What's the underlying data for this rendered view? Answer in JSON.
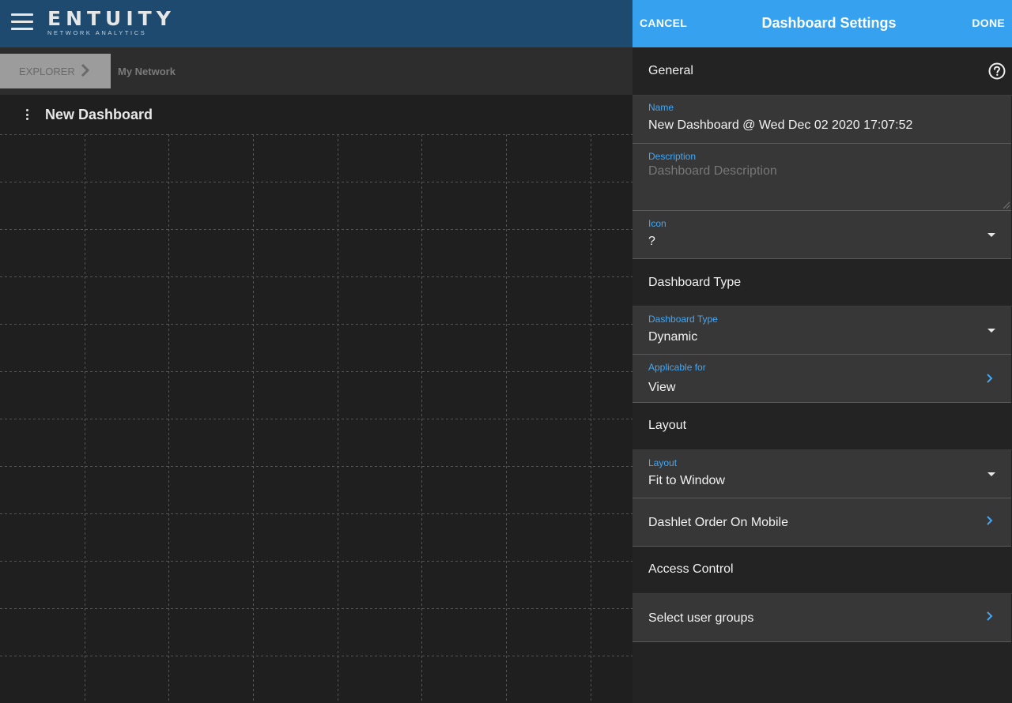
{
  "app": {
    "logo_main": "ENTUITY",
    "logo_sub": "NETWORK ANALYTICS"
  },
  "breadcrumb": {
    "explorer": "EXPLORER",
    "current": "My Network"
  },
  "dashboard": {
    "title": "New Dashboard"
  },
  "panel": {
    "cancel": "CANCEL",
    "title": "Dashboard Settings",
    "done": "DONE",
    "sections": {
      "general": "General",
      "dashboard_type": "Dashboard Type",
      "layout": "Layout",
      "access_control": "Access Control"
    },
    "fields": {
      "name": {
        "label": "Name",
        "value": "New Dashboard @ Wed Dec 02 2020 17:07:52"
      },
      "description": {
        "label": "Description",
        "placeholder": "Dashboard Description"
      },
      "icon": {
        "label": "Icon",
        "value": "?"
      },
      "dashboard_type": {
        "label": "Dashboard Type",
        "value": "Dynamic"
      },
      "applicable_for": {
        "label": "Applicable for",
        "value": "View"
      },
      "layout": {
        "label": "Layout",
        "value": "Fit to Window"
      },
      "dashlet_order": {
        "value": "Dashlet Order On Mobile"
      },
      "user_groups": {
        "value": "Select user groups"
      }
    }
  },
  "colors": {
    "topbar": "#1d4a6e",
    "panel_header": "#36a2ef",
    "accent_label": "#42a7f5"
  },
  "icons": [
    "menu-icon",
    "chevron-right-icon",
    "more-vert-icon",
    "help-circle-icon",
    "dropdown-caret-icon"
  ]
}
